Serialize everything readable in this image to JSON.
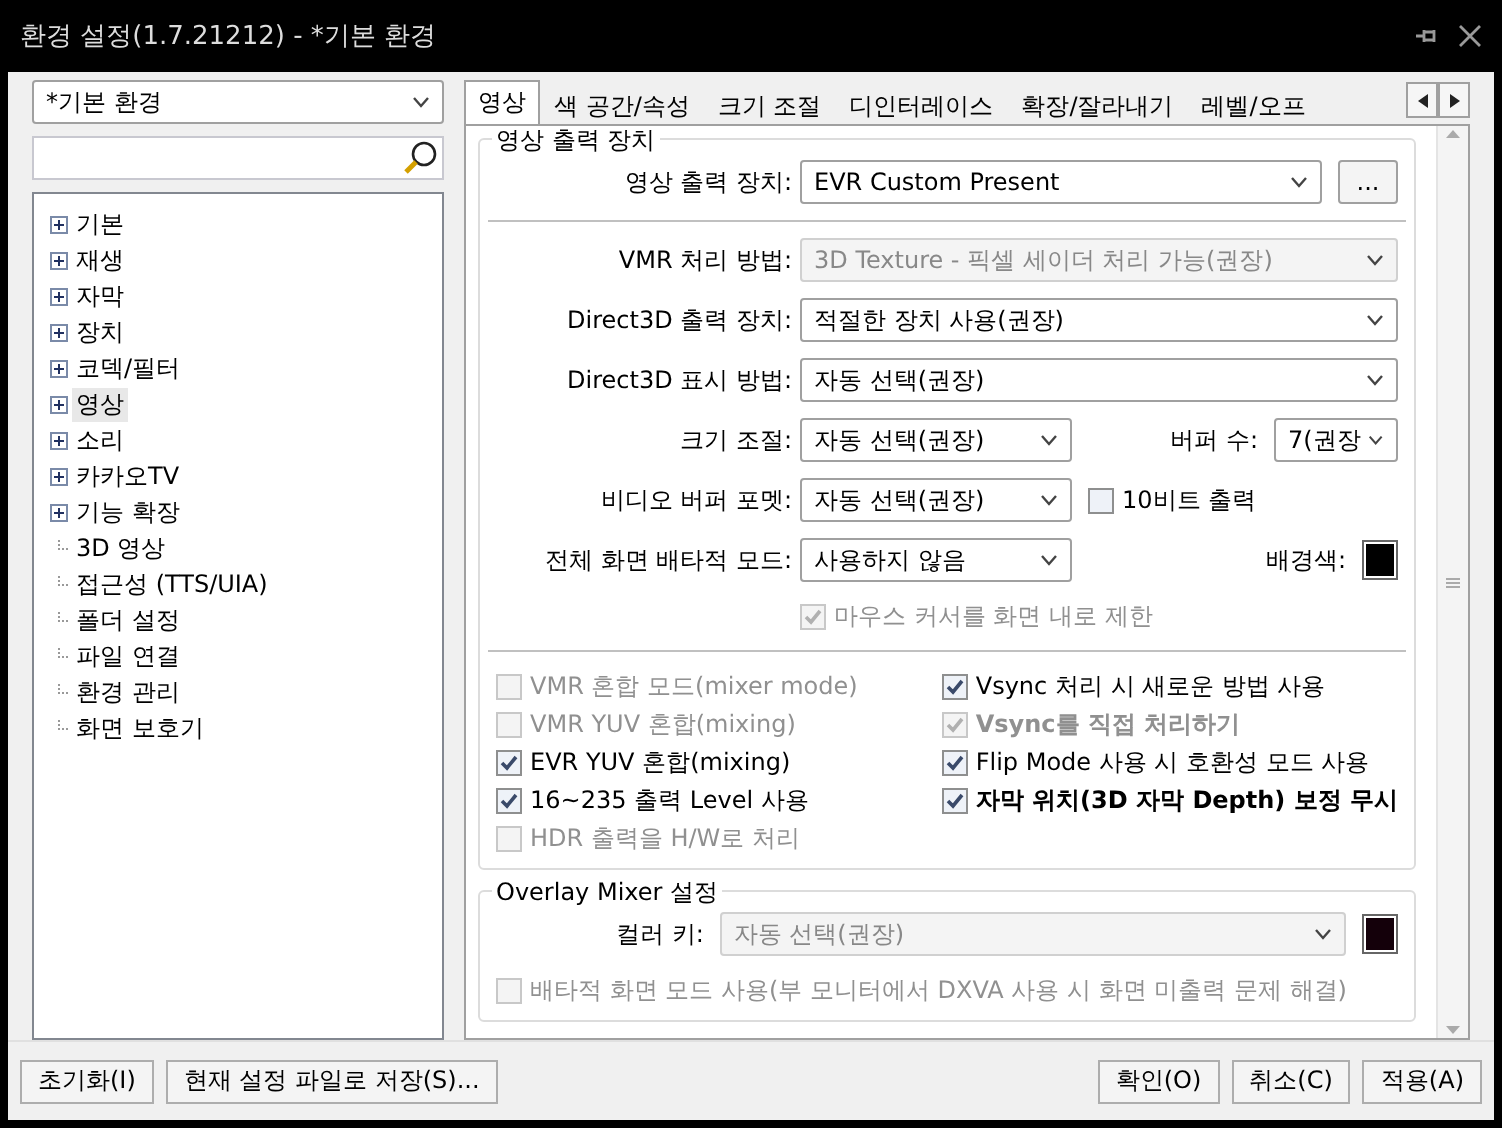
{
  "window": {
    "title": "환경 설정(1.7.21212) - *기본 환경"
  },
  "profile": {
    "value": "*기본 환경"
  },
  "tree": [
    {
      "label": "기본",
      "kind": "expandable",
      "selected": false
    },
    {
      "label": "재생",
      "kind": "expandable",
      "selected": false
    },
    {
      "label": "자막",
      "kind": "expandable",
      "selected": false
    },
    {
      "label": "장치",
      "kind": "expandable",
      "selected": false
    },
    {
      "label": "코덱/필터",
      "kind": "expandable",
      "selected": false
    },
    {
      "label": "영상",
      "kind": "expandable",
      "selected": true
    },
    {
      "label": "소리",
      "kind": "expandable",
      "selected": false
    },
    {
      "label": "카카오TV",
      "kind": "expandable",
      "selected": false
    },
    {
      "label": "기능 확장",
      "kind": "expandable",
      "selected": false
    },
    {
      "label": "3D 영상",
      "kind": "leaf",
      "selected": false
    },
    {
      "label": "접근성 (TTS/UIA)",
      "kind": "leaf",
      "selected": false
    },
    {
      "label": "폴더 설정",
      "kind": "leaf",
      "selected": false
    },
    {
      "label": "파일 연결",
      "kind": "leaf",
      "selected": false
    },
    {
      "label": "환경 관리",
      "kind": "leaf",
      "selected": false
    },
    {
      "label": "화면 보호기",
      "kind": "leaf",
      "selected": false
    }
  ],
  "tabs": [
    {
      "label": "영상",
      "selected": true
    },
    {
      "label": "색 공간/속성",
      "selected": false
    },
    {
      "label": "크기 조절",
      "selected": false
    },
    {
      "label": "디인터레이스",
      "selected": false
    },
    {
      "label": "확장/잘라내기",
      "selected": false
    },
    {
      "label": "레벨/오프",
      "selected": false
    }
  ],
  "output_group": {
    "title": "영상 출력 장치",
    "output_device": {
      "label": "영상 출력 장치:",
      "value": "EVR Custom Present",
      "button": "..."
    },
    "vmr_method": {
      "label": "VMR 처리 방법:",
      "value": "3D Texture - 픽셀 세이더 처리 가능(권장)",
      "disabled": true
    },
    "d3d_device": {
      "label": "Direct3D 출력 장치:",
      "value": "적절한 장치 사용(권장)",
      "disabled": false
    },
    "d3d_display": {
      "label": "Direct3D 표시 방법:",
      "value": "자동 선택(권장)",
      "disabled": false
    },
    "resize": {
      "label": "크기 조절:",
      "value": "자동 선택(권장)"
    },
    "buffer_count": {
      "label": "버퍼 수:",
      "value": "7(권장"
    },
    "buffer_format": {
      "label": "비디오 버퍼 포멧:",
      "value": "자동 선택(권장)"
    },
    "ten_bit": {
      "label": "10비트 출력",
      "checked": false,
      "disabled": false
    },
    "fullscreen": {
      "label": "전체 화면 배타적 모드:",
      "value": "사용하지 않음"
    },
    "background": {
      "label": "배경색:",
      "color": "#000000"
    },
    "mouse_cursor": {
      "label": "마우스 커서를 화면 내로 제한",
      "checked": true,
      "disabled": true
    },
    "options": [
      {
        "label": "VMR 혼합 모드(mixer mode)",
        "checked": false,
        "disabled": true,
        "bold": false
      },
      {
        "label": "Vsync 처리 시 새로운 방법 사용",
        "checked": true,
        "disabled": false,
        "bold": false
      },
      {
        "label": "VMR YUV 혼합(mixing)",
        "checked": false,
        "disabled": true,
        "bold": false
      },
      {
        "label": "Vsync를 직접 처리하기",
        "checked": true,
        "disabled": true,
        "bold": true
      },
      {
        "label": "EVR YUV 혼합(mixing)",
        "checked": true,
        "disabled": false,
        "bold": false
      },
      {
        "label": "Flip Mode 사용 시 호환성 모드 사용",
        "checked": true,
        "disabled": false,
        "bold": false
      },
      {
        "label": "16~235 출력 Level 사용",
        "checked": true,
        "disabled": false,
        "bold": false
      },
      {
        "label": "자막 위치(3D 자막 Depth) 보정 무시",
        "checked": true,
        "disabled": false,
        "bold": true
      },
      {
        "label": "HDR 출력을 H/W로 처리",
        "checked": false,
        "disabled": true,
        "bold": false
      }
    ]
  },
  "overlay_group": {
    "title": "Overlay Mixer 설정",
    "color_key": {
      "label": "컬러 키:",
      "value": "자동 선택(권장)",
      "disabled": true,
      "color": "#14000a"
    },
    "exclusive": {
      "label": "배타적 화면 모드 사용(부 모니터에서 DXVA 사용 시 화면 미출력 문제 해결)",
      "checked": false,
      "disabled": true
    }
  },
  "buttons_left": [
    "초기화(I)",
    "현재 설정 파일로 저장(S)..."
  ],
  "buttons_right": [
    "확인(O)",
    "취소(C)",
    "적용(A)"
  ]
}
